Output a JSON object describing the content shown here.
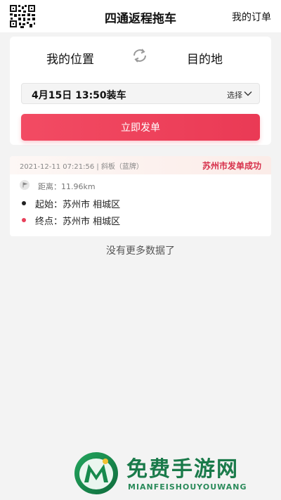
{
  "header": {
    "title": "四通返程拖车",
    "my_orders": "我的订单",
    "qr_icon": "qr-code-icon"
  },
  "route": {
    "from_label": "我的位置",
    "to_label": "目的地",
    "swap_icon": "swap-icon"
  },
  "time": {
    "value": "4月15日 13:50装车",
    "select_label": "选择",
    "chevron_icon": "chevron-down-icon"
  },
  "submit_label": "立即发单",
  "records": [
    {
      "meta": "2021-12-11 07:21:56 | 斜板（蓝牌）",
      "status": "苏州市发单成功",
      "distance": "距离：11.96km",
      "start": "起始：苏州市 相城区",
      "end": "终点：苏州市 相城区"
    }
  ],
  "empty_hint": "没有更多数据了",
  "watermark": {
    "title": "免费手游网",
    "subtitle": "MIANFEISHOUYOUWANG"
  },
  "colors": {
    "accent": "#ea3a55",
    "status": "#d7304b",
    "background": "#f3f3f3",
    "start_dot": "#222222",
    "end_dot": "#e8405a"
  }
}
